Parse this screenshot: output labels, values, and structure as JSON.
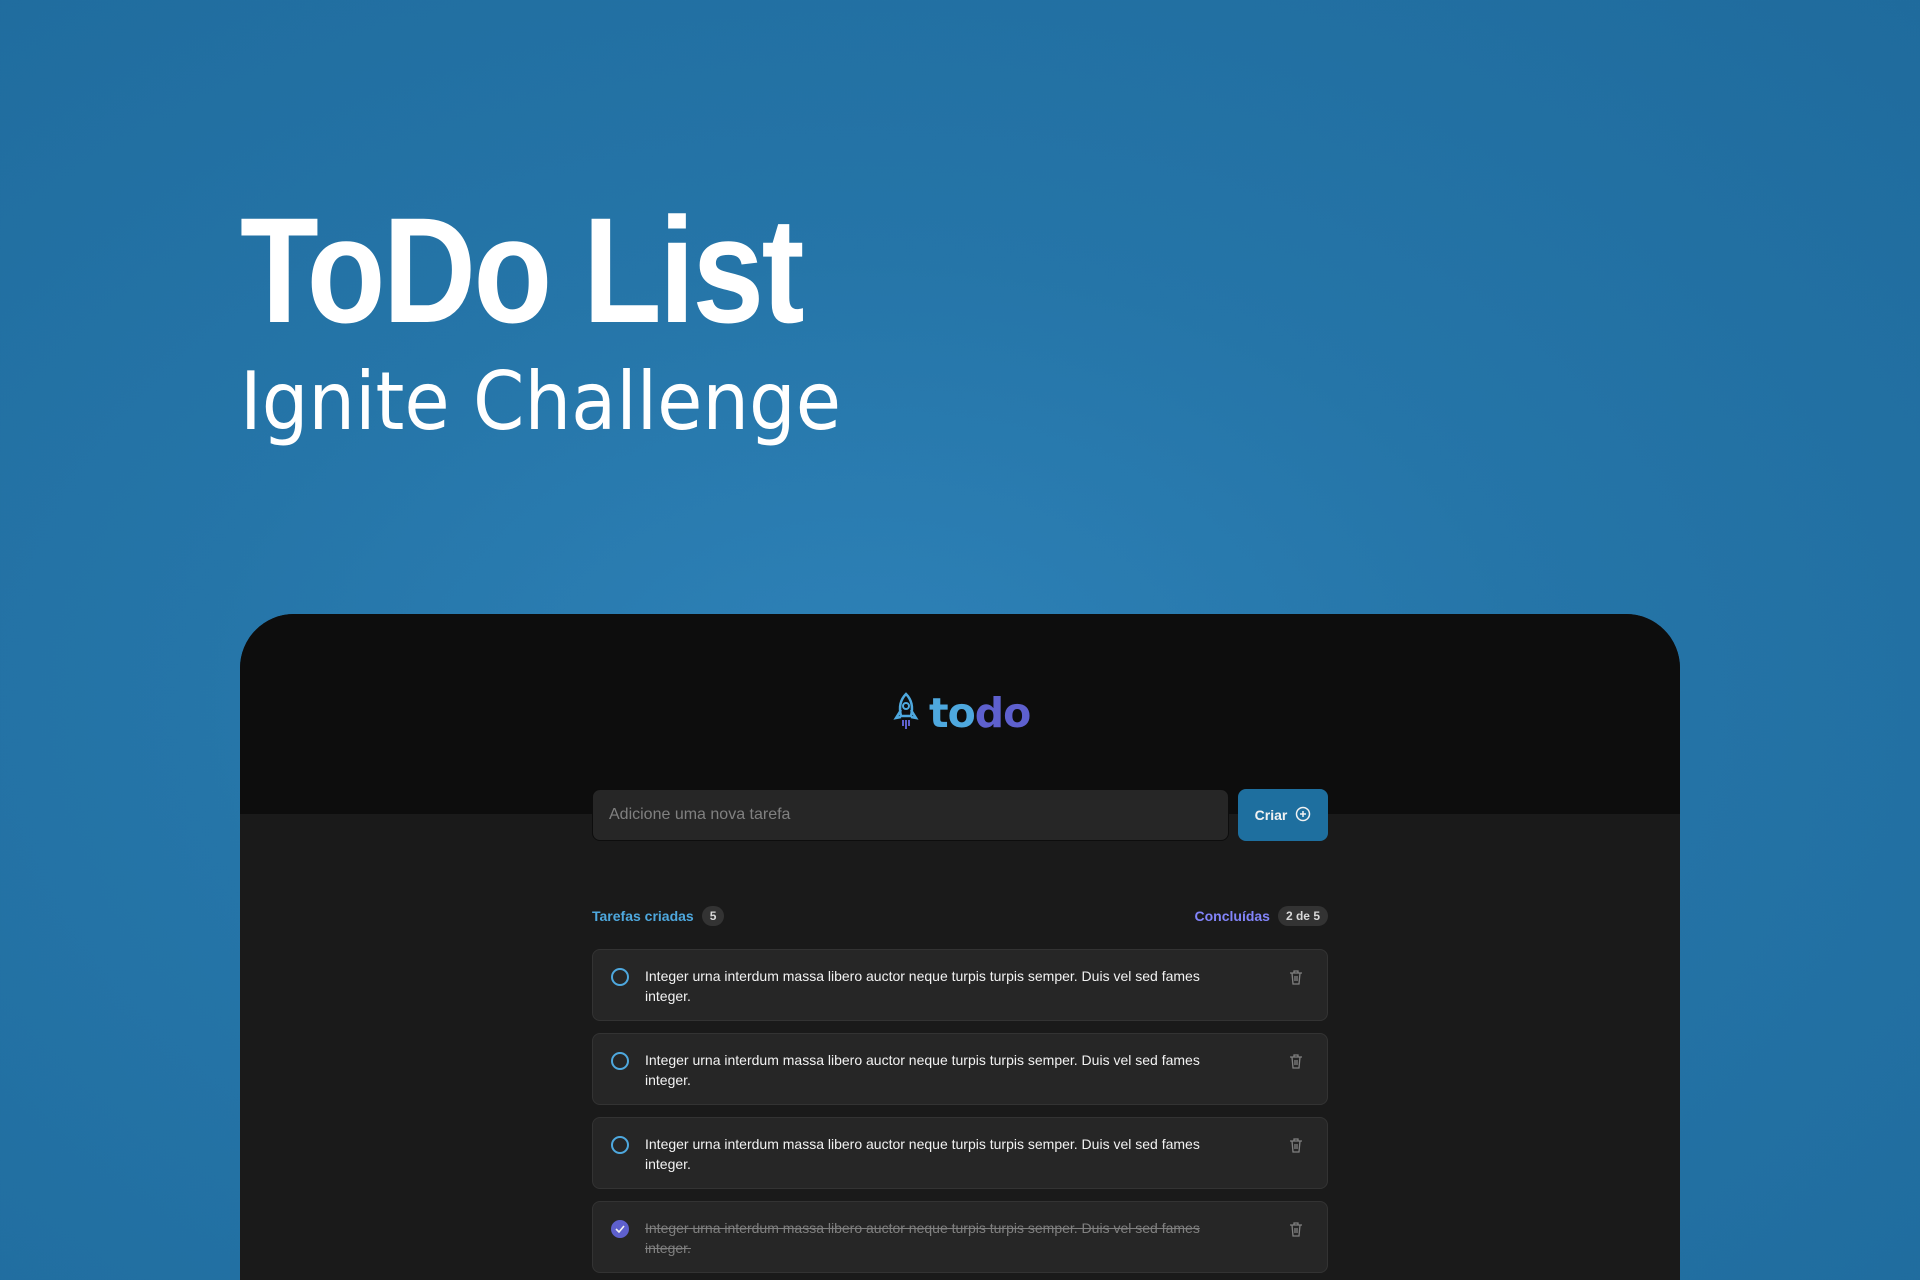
{
  "hero": {
    "title": "ToDo List",
    "subtitle": "Ignite Challenge"
  },
  "app": {
    "logo": {
      "part1": "to",
      "part2": "do",
      "icon": "rocket-icon"
    },
    "input_placeholder": "Adicione uma nova tarefa",
    "create_button": {
      "label": "Criar",
      "icon": "plus-circle-icon"
    },
    "counters": {
      "created_label": "Tarefas criadas",
      "created_count": "5",
      "done_label": "Concluídas",
      "done_count": "2 de 5"
    },
    "tasks": [
      {
        "text": "Integer urna interdum massa libero auctor neque turpis turpis semper. Duis vel sed fames integer.",
        "done": false
      },
      {
        "text": "Integer urna interdum massa libero auctor neque turpis turpis semper. Duis vel sed fames integer.",
        "done": false
      },
      {
        "text": "Integer urna interdum massa libero auctor neque turpis turpis semper. Duis vel sed fames integer.",
        "done": false
      },
      {
        "text": "Integer urna interdum massa libero auctor neque turpis turpis semper. Duis vel sed fames integer.",
        "done": true
      }
    ]
  },
  "colors": {
    "background": "#2575a8",
    "accent_blue": "#4ea8de",
    "accent_purple": "#5e60ce",
    "button": "#1e6f9f"
  }
}
